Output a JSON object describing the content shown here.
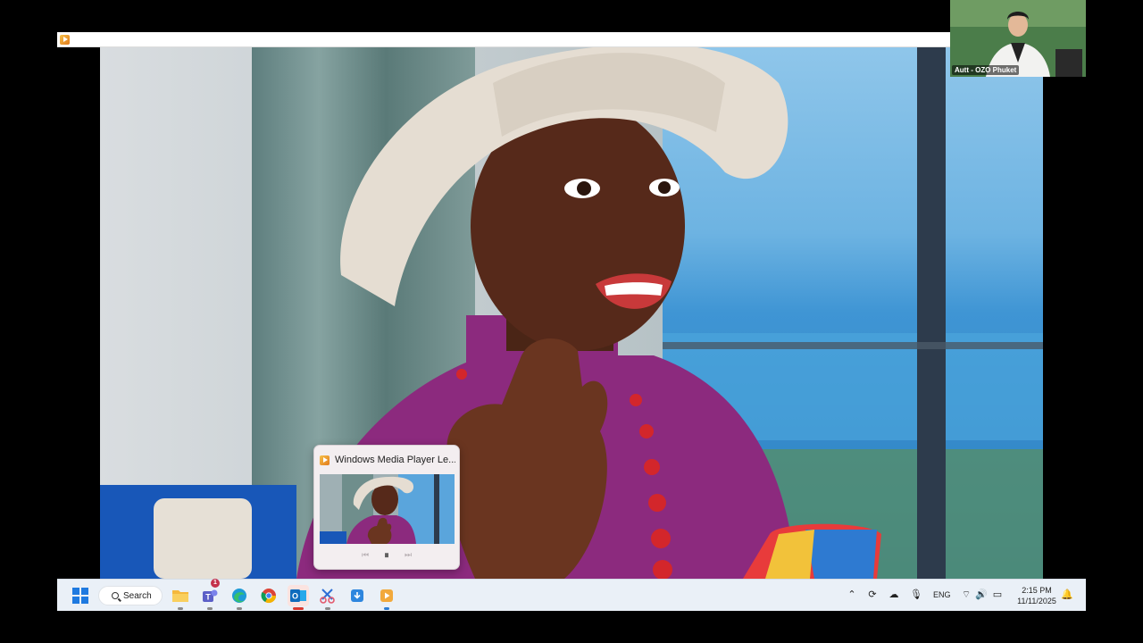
{
  "player": {
    "title_icon": "windows-media-player-icon"
  },
  "webcam": {
    "label": "Autt - OZO Phuket"
  },
  "thumbnail": {
    "title": "Windows Media Player Le...",
    "controls": [
      "previous-icon",
      "pause-icon",
      "next-icon"
    ]
  },
  "taskbar": {
    "search_label": "Search",
    "apps": [
      {
        "name": "file-explorer-icon",
        "active": false
      },
      {
        "name": "teams-icon",
        "active": false,
        "badge": "1"
      },
      {
        "name": "edge-icon",
        "active": false
      },
      {
        "name": "chrome-icon",
        "active": false
      },
      {
        "name": "outlook-icon",
        "active": true
      },
      {
        "name": "snipping-tool-icon",
        "active": false
      },
      {
        "name": "app-installer-icon",
        "active": false
      },
      {
        "name": "media-player-icon",
        "active": false
      }
    ],
    "tray": {
      "language": "ENG",
      "time": "2:15 PM",
      "date": "11/11/2025"
    }
  },
  "colors": {
    "taskbar_bg": "#eaf0f7",
    "accent": "#d9382e",
    "badge": "#c4314b"
  }
}
